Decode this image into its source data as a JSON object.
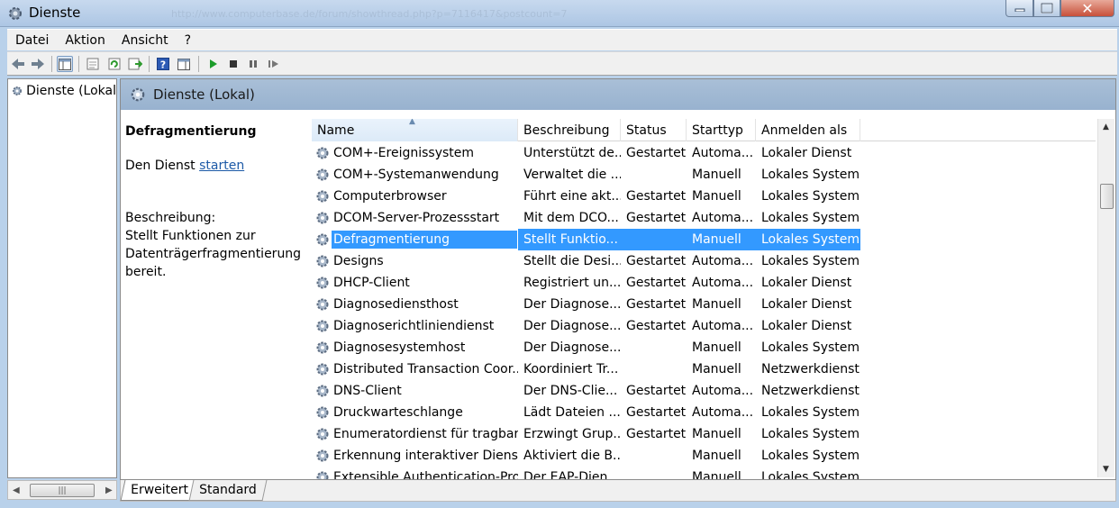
{
  "window": {
    "title": "Dienste",
    "ghost_url": "http://www.computerbase.de/forum/showthread.php?p=7116417&postcount=7"
  },
  "menu": [
    "Datei",
    "Aktion",
    "Ansicht",
    "?"
  ],
  "tree": {
    "root_label": "Dienste (Lokal"
  },
  "header": {
    "title": "Dienste (Lokal)"
  },
  "detail": {
    "service_name": "Defragmentierung",
    "start_prefix": "Den Dienst",
    "start_link": "starten",
    "desc_label": "Beschreibung:",
    "desc_text": "Stellt Funktionen zur Datenträgerfragmentierung bereit."
  },
  "columns": [
    "Name",
    "Beschreibung",
    "Status",
    "Starttyp",
    "Anmelden als"
  ],
  "rows": [
    [
      "COM+-Ereignissystem",
      "Unterstützt de...",
      "Gestartet",
      "Automa...",
      "Lokaler Dienst"
    ],
    [
      "COM+-Systemanwendung",
      "Verwaltet die ...",
      "",
      "Manuell",
      "Lokales System"
    ],
    [
      "Computerbrowser",
      "Führt eine akt...",
      "Gestartet",
      "Manuell",
      "Lokales System"
    ],
    [
      "DCOM-Server-Prozessstart",
      "Mit dem DCO...",
      "Gestartet",
      "Automa...",
      "Lokales System"
    ],
    [
      "Defragmentierung",
      "Stellt Funktio...",
      "",
      "Manuell",
      "Lokales System"
    ],
    [
      "Designs",
      "Stellt die Desi...",
      "Gestartet",
      "Automa...",
      "Lokales System"
    ],
    [
      "DHCP-Client",
      "Registriert un...",
      "Gestartet",
      "Automa...",
      "Lokaler Dienst"
    ],
    [
      "Diagnosediensthost",
      "Der Diagnose...",
      "Gestartet",
      "Manuell",
      "Lokaler Dienst"
    ],
    [
      "Diagnoserichtliniendienst",
      "Der Diagnose...",
      "Gestartet",
      "Automa...",
      "Lokaler Dienst"
    ],
    [
      "Diagnosesystemhost",
      "Der Diagnose...",
      "",
      "Manuell",
      "Lokales System"
    ],
    [
      "Distributed Transaction Coor...",
      "Koordiniert Tr...",
      "",
      "Manuell",
      "Netzwerkdienst"
    ],
    [
      "DNS-Client",
      "Der DNS-Clie...",
      "Gestartet",
      "Automa...",
      "Netzwerkdienst"
    ],
    [
      "Druckwarteschlange",
      "Lädt Dateien ...",
      "Gestartet",
      "Automa...",
      "Lokales System"
    ],
    [
      "Enumeratordienst für tragbar...",
      "Erzwingt Grup...",
      "Gestartet",
      "Manuell",
      "Lokales System"
    ],
    [
      "Erkennung interaktiver Dienste",
      "Aktiviert die B...",
      "",
      "Manuell",
      "Lokales System"
    ],
    [
      "Extensible Authentication-Pro...",
      "Der EAP-Dien...",
      "",
      "Manuell",
      "Lokales System"
    ]
  ],
  "selected_row": 4,
  "tabs": [
    "Erweitert",
    "Standard"
  ],
  "colors": {
    "selection": "#3399ff",
    "link": "#1d5aa7",
    "header_band": "#98b2cf"
  },
  "icons": [
    "back-arrow-icon",
    "forward-arrow-icon",
    "console-tree-icon",
    "properties-icon",
    "refresh-icon",
    "export-list-icon",
    "help-icon",
    "show-hide-icon",
    "play-icon",
    "stop-icon",
    "pause-icon",
    "restart-icon",
    "gear-icon"
  ]
}
